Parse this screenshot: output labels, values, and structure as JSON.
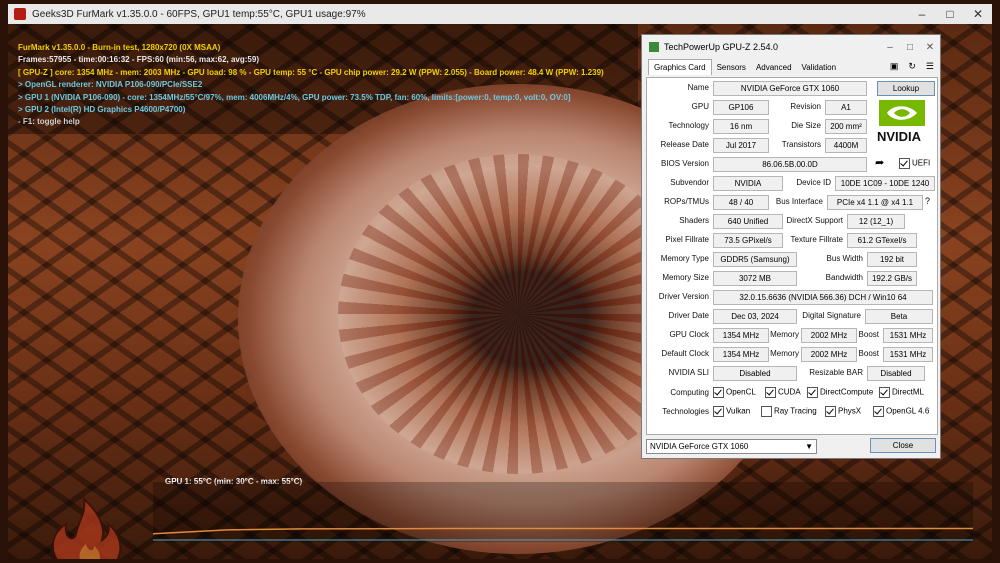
{
  "furmark": {
    "window_title": "Geeks3D FurMark v1.35.0.0 - 60FPS, GPU1 temp:55°C, GPU1 usage:97%",
    "hud": [
      {
        "text": "FurMark v1.35.0.0 - Burn-in test, 1280x720 (0X MSAA)",
        "color": "yellow"
      },
      {
        "text": "Frames:57955 - time:00:16:32 - FPS:60 (min:56, max:62, avg:59)",
        "color": "white"
      },
      {
        "text": "[ GPU-Z ] core: 1354 MHz - mem: 2003 MHz - GPU load: 98 % - GPU temp: 55 °C - GPU chip power: 29.2 W (PPW: 2.055) - Board power: 48.4 W (PPW: 1.239)",
        "color": "yellow"
      },
      {
        "text": "> OpenGL renderer: NVIDIA P106-090/PCIe/SSE2",
        "color": "cyan"
      },
      {
        "text": "> GPU 1 (NVIDIA P106-090) - core: 1354MHz/55°C/97%, mem: 4006MHz/4%, GPU power: 73.5% TDP, fan: 60%, limits:[power:0, temp:0, volt:0, OV:0]",
        "color": "cyan"
      },
      {
        "text": "> GPU 2 (Intel(R) HD Graphics P4600/P4700)",
        "color": "cyan"
      },
      {
        "text": "- F1: toggle help",
        "color": "grey"
      }
    ],
    "graph_label": "GPU 1: 55°C (min: 30°C - max: 55°C)",
    "temp_trace_c": [
      30,
      48,
      53,
      54,
      55,
      55,
      55,
      55,
      55,
      55,
      55,
      55
    ],
    "logo_text": "FurMark"
  },
  "gpuz": {
    "title": "TechPowerUp GPU-Z 2.54.0",
    "tabs": [
      "Graphics Card",
      "Sensors",
      "Advanced",
      "Validation"
    ],
    "active_tab": "Graphics Card",
    "labels": {
      "name": "Name",
      "gpu": "GPU",
      "revision": "Revision",
      "technology": "Technology",
      "die_size": "Die Size",
      "release_date": "Release Date",
      "transistors": "Transistors",
      "bios": "BIOS Version",
      "subvendor": "Subvendor",
      "device_id": "Device ID",
      "rops": "ROPs/TMUs",
      "bus": "Bus Interface",
      "shaders": "Shaders",
      "directx": "DirectX Support",
      "pixel": "Pixel Fillrate",
      "texture": "Texture Fillrate",
      "memtype": "Memory Type",
      "buswidth": "Bus Width",
      "memsize": "Memory Size",
      "bandwidth": "Bandwidth",
      "driver": "Driver Version",
      "driverdate": "Driver Date",
      "digsig": "Digital Signature",
      "gpuclock": "GPU Clock",
      "memory": "Memory",
      "boost": "Boost",
      "defclock": "Default Clock",
      "sli": "NVIDIA SLI",
      "rbar": "Resizable BAR",
      "computing": "Computing",
      "technologies": "Technologies"
    },
    "values": {
      "name": "NVIDIA GeForce GTX 1060",
      "gpu": "GP106",
      "revision": "A1",
      "technology": "16 nm",
      "die_size": "200 mm²",
      "release_date": "Jul 2017",
      "transistors": "4400M",
      "bios": "86.06.5B.00.0D",
      "subvendor": "NVIDIA",
      "device_id": "10DE 1C09 - 10DE 1240",
      "rops": "48 / 40",
      "bus": "PCIe x4 1.1 @ x4 1.1",
      "shaders": "640 Unified",
      "directx": "12 (12_1)",
      "pixel": "73.5 GPixel/s",
      "texture": "61.2 GTexel/s",
      "memtype": "GDDR5 (Samsung)",
      "buswidth": "192 bit",
      "memsize": "3072 MB",
      "bandwidth": "192.2 GB/s",
      "driver": "32.0.15.6636 (NVIDIA 566.36) DCH / Win10 64",
      "driverdate": "Dec 03, 2024",
      "digsig": "Beta",
      "gpuclock": "1354 MHz",
      "gpumem": "2002 MHz",
      "gpuboost": "1531 MHz",
      "defclock": "1354 MHz",
      "defmem": "2002 MHz",
      "defboost": "1531 MHz",
      "sli": "Disabled",
      "rbar": "Disabled"
    },
    "lookup": "Lookup",
    "uefi": "UEFI",
    "bus_help": "?",
    "computing": [
      {
        "label": "OpenCL",
        "checked": true
      },
      {
        "label": "CUDA",
        "checked": true
      },
      {
        "label": "DirectCompute",
        "checked": true
      },
      {
        "label": "DirectML",
        "checked": true
      }
    ],
    "technologies": [
      {
        "label": "Vulkan",
        "checked": true
      },
      {
        "label": "Ray Tracing",
        "checked": false
      },
      {
        "label": "PhysX",
        "checked": true
      },
      {
        "label": "OpenGL 4.6",
        "checked": true
      }
    ],
    "selected_gpu": "NVIDIA GeForce GTX 1060",
    "close": "Close",
    "nvidia_logo": "NVIDIA"
  }
}
